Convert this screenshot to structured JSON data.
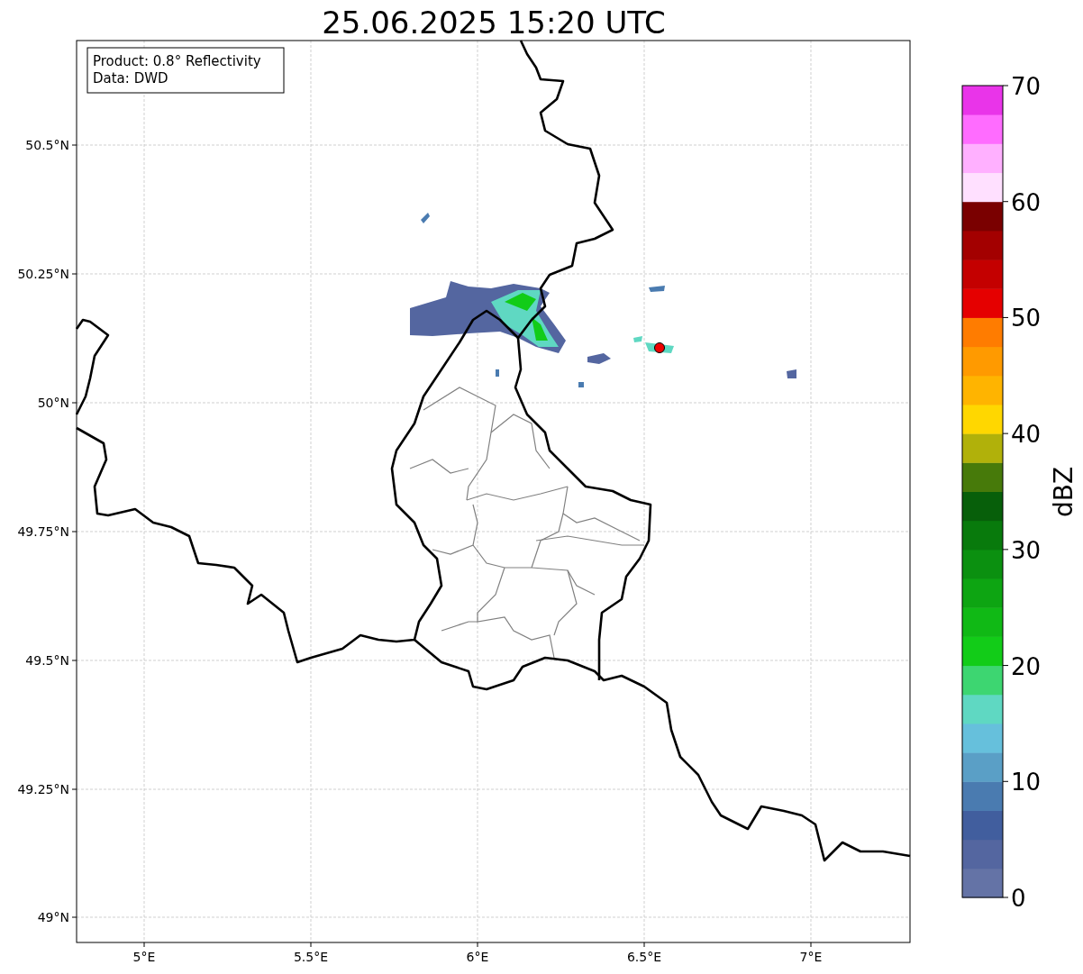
{
  "title": "25.06.2025 15:20 UTC",
  "info_box": [
    "Product: 0.8° Reflectivity",
    "Data: DWD"
  ],
  "x_ticks": [
    "5°E",
    "5.5°E",
    "6°E",
    "6.5°E",
    "7°E"
  ],
  "y_ticks": [
    "50.5°N",
    "50.25°N",
    "50°N",
    "49.75°N",
    "49.5°N",
    "49.25°N",
    "49°N"
  ],
  "colorbar": {
    "label": "dBZ",
    "ticks": [
      "70",
      "60",
      "50",
      "40",
      "30",
      "20",
      "10",
      "0"
    ],
    "segments": [
      {
        "color": "#6473a6"
      },
      {
        "color": "#5466a0"
      },
      {
        "color": "#415e9e"
      },
      {
        "color": "#4a7bb0"
      },
      {
        "color": "#5a9fc6"
      },
      {
        "color": "#66c0dc"
      },
      {
        "color": "#5fd8c2"
      },
      {
        "color": "#3dd671"
      },
      {
        "color": "#12cc18"
      },
      {
        "color": "#10b915"
      },
      {
        "color": "#0da512"
      },
      {
        "color": "#0b9010"
      },
      {
        "color": "#087a0c"
      },
      {
        "color": "#075f0a"
      },
      {
        "color": "#477a0a"
      },
      {
        "color": "#b1b10a"
      },
      {
        "color": "#ffd700"
      },
      {
        "color": "#ffb400"
      },
      {
        "color": "#ff9a00"
      },
      {
        "color": "#ff7c00"
      },
      {
        "color": "#e50000"
      },
      {
        "color": "#c40000"
      },
      {
        "color": "#a30000"
      },
      {
        "color": "#7a0000"
      },
      {
        "color": "#ffe0ff"
      },
      {
        "color": "#ffb0ff"
      },
      {
        "color": "#ff6cff"
      },
      {
        "color": "#e934e9"
      }
    ]
  }
}
